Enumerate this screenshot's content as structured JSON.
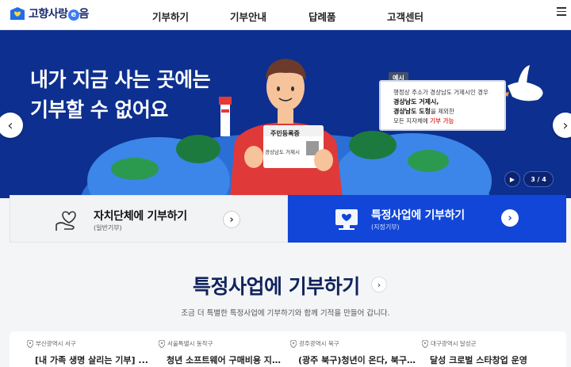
{
  "header": {
    "logo_text": "고향사랑",
    "logo_e": "e",
    "logo_suffix": "음",
    "nav": [
      {
        "label": "기부하기"
      },
      {
        "label": "기부안내"
      },
      {
        "label": "답례품"
      },
      {
        "label": "고객센터"
      }
    ],
    "menu_icon": "hamburger-icon"
  },
  "banner": {
    "title_line1": "내가 지금 사는 곳에는",
    "title_line2": "기부할 수 없어요",
    "card_label": "주민등록증",
    "card_region": "경상남도 거제시",
    "example": {
      "tag": "예시",
      "line1": "행정상 주소가 경상남도 거제시인 경우",
      "line2": "경상남도 거제시,",
      "line3a": "경상남도 도청",
      "line3b": "을 제외한",
      "line4a": "모든 지자체에 ",
      "line4b": "기부 가능"
    },
    "prev_icon": "chevron-left-icon",
    "next_icon": "chevron-right-icon",
    "play_icon": "play-icon",
    "page_indicator": "3 / 4",
    "current_slide": 3,
    "total_slides": 4,
    "colors": {
      "background": "#0d2f8f",
      "accent_red": "#e53935"
    }
  },
  "cards": {
    "left": {
      "title": "자치단체에 기부하기",
      "sub": "(일반기부)",
      "icon": "heart-hand-icon"
    },
    "right": {
      "title": "특정사업에 기부하기",
      "sub": "(지정기부)",
      "icon": "project-icon",
      "color": "#1146d8"
    }
  },
  "section": {
    "title": "특정사업에 기부하기",
    "desc": "조금 더 특별한 특정사업에 기부하기와 함께 기적을 만들어 갑니다.",
    "items": [
      {
        "location": "부산광역시 서구",
        "title": "[내 가족 생명 살리는 기부] ..."
      },
      {
        "location": "서울특별시 동작구",
        "title": "청년 소프트웨어 구매비용 지원..."
      },
      {
        "location": "광주광역시 북구",
        "title": "(광주 북구)청년이 온다, 북구 ..."
      },
      {
        "location": "대구광역시 달성군",
        "title": "달성 크로벌 스타창업 운영"
      }
    ]
  }
}
